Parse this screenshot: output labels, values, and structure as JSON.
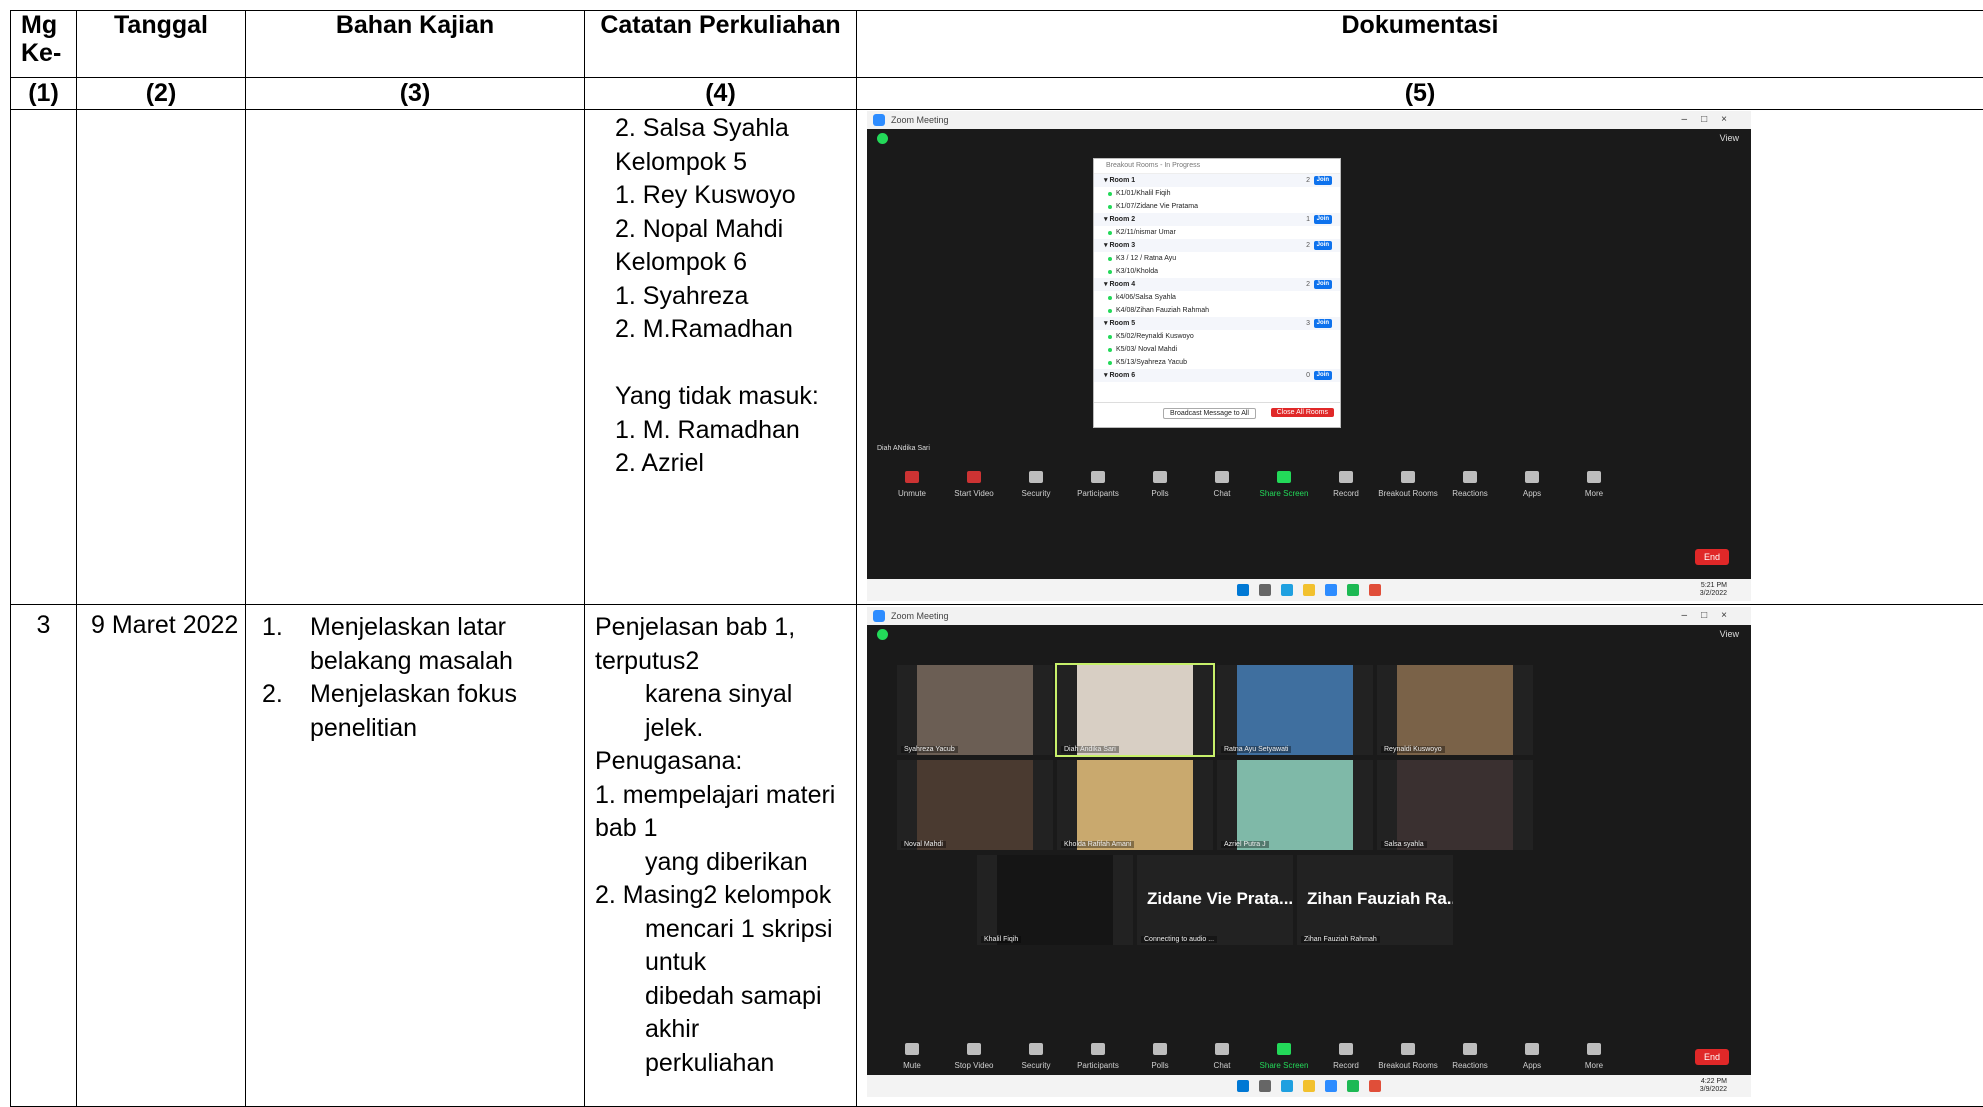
{
  "header": {
    "col1": "Mg Ke-",
    "col2": "Tanggal",
    "col3": "Bahan Kajian",
    "col4": "Catatan Perkuliahan",
    "col5": "Dokumentasi"
  },
  "numbering": [
    "(1)",
    "(2)",
    "(3)",
    "(4)",
    "(5)"
  ],
  "row1": {
    "notes": [
      "2. Salsa Syahla",
      "Kelompok 5",
      "1. Rey Kuswoyo",
      "2. Nopal Mahdi",
      "Kelompok 6",
      "1. Syahreza",
      "2.  M.Ramadhan",
      "",
      "Yang tidak masuk:",
      "1. M. Ramadhan",
      "2. Azriel"
    ],
    "screenshot": {
      "window_title": "Zoom Meeting",
      "view_label": "View",
      "panel_title": "Breakout Rooms - In Progress",
      "rooms": [
        {
          "name": "Room 1",
          "count": "2",
          "members": [
            "K1/01/Khalil Fiqih",
            "K1/07/Zidane Vie Pratama"
          ]
        },
        {
          "name": "Room 2",
          "count": "1",
          "members": [
            "K2/11/nismar Umar"
          ]
        },
        {
          "name": "Room 3",
          "count": "2",
          "members": [
            "K3 / 12 / Ratna Ayu",
            "K3/10/Kholda"
          ]
        },
        {
          "name": "Room 4",
          "count": "2",
          "members": [
            "k4/06/Salsa Syahla",
            "K4/08/Zihan Fauziah Rahmah"
          ]
        },
        {
          "name": "Room 5",
          "count": "3",
          "members": [
            "K5/02/Reynaldi Kuswoyo",
            "K5/03/ Noval Mahdi",
            "K5/13/Syahreza Yacub"
          ]
        },
        {
          "name": "Room 6",
          "count": "0",
          "members": []
        }
      ],
      "join_label": "Join",
      "broadcast_label": "Broadcast Message to All",
      "close_all_label": "Close All Rooms",
      "speaker": "Diah ANdika Sari",
      "toolbar": [
        "Unmute",
        "Start Video",
        "Security",
        "Participants",
        "Polls",
        "Chat",
        "Share Screen",
        "Record",
        "Breakout Rooms",
        "Reactions",
        "Apps",
        "More"
      ],
      "end_label": "End",
      "clock_time": "5:21 PM",
      "clock_date": "3/2/2022"
    }
  },
  "row2": {
    "week": "3",
    "date": "9 Maret 2022",
    "topics": [
      {
        "n": "1.",
        "text": "Menjelaskan latar belakang masalah"
      },
      {
        "n": "2.",
        "text": "Menjelaskan fokus penelitian"
      }
    ],
    "notes": {
      "p1": "Penjelasan bab 1, terputus2",
      "p1b": "karena sinyal jelek.",
      "p2": "Penugasana:",
      "i1a": "1. mempelajari materi  bab 1",
      "i1b": "yang diberikan",
      "i2a": "2. Masing2 kelompok",
      "i2b": "mencari 1 skripsi untuk",
      "i2c": "dibedah samapi akhir",
      "i2d": "perkuliahan"
    },
    "screenshot": {
      "window_title": "Zoom Meeting",
      "view_label": "View",
      "tiles": [
        "Syahreza Yacub",
        "Diah Andika Sari",
        "Ratna Ayu Setyawati",
        "Reynaldi Kuswoyo",
        "Noval Mahdi",
        "Kholda Rafifah Amani",
        "Azriel Putra J",
        "Salsa syahla",
        "Khalil Fiqih",
        "Connecting to audio ...",
        "Zihan Fauziah Rahmah"
      ],
      "big_names": [
        "Zidane Vie Prata...",
        "Zihan Fauziah Ra..."
      ],
      "toolbar": [
        "Mute",
        "Stop Video",
        "Security",
        "Participants",
        "Polls",
        "Chat",
        "Share Screen",
        "Record",
        "Breakout Rooms",
        "Reactions",
        "Apps",
        "More"
      ],
      "end_label": "End",
      "clock_time": "4:22 PM",
      "clock_date": "3/9/2022"
    }
  }
}
